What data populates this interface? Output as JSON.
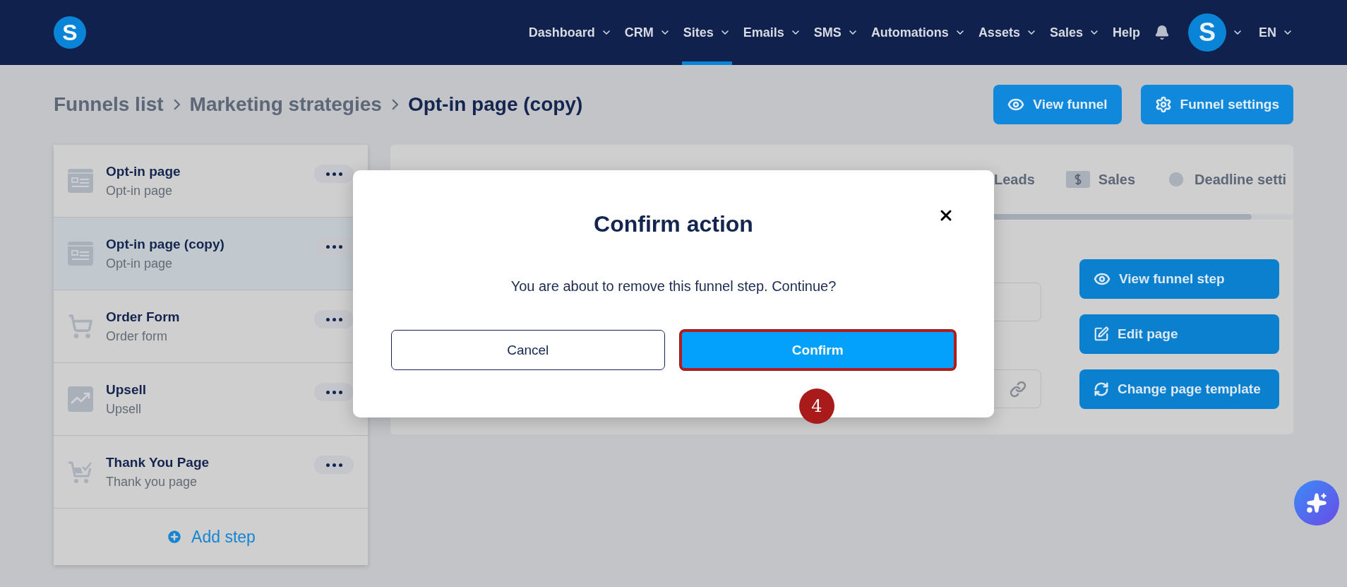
{
  "nav": {
    "logo": "S",
    "items": [
      {
        "label": "Dashboard",
        "selected": false,
        "dropdown": true
      },
      {
        "label": "CRM",
        "selected": false,
        "dropdown": true
      },
      {
        "label": "Sites",
        "selected": true,
        "dropdown": true
      },
      {
        "label": "Emails",
        "selected": false,
        "dropdown": true
      },
      {
        "label": "SMS",
        "selected": false,
        "dropdown": true
      },
      {
        "label": "Automations",
        "selected": false,
        "dropdown": true
      },
      {
        "label": "Assets",
        "selected": false,
        "dropdown": true
      },
      {
        "label": "Sales",
        "selected": false,
        "dropdown": true
      },
      {
        "label": "Help",
        "selected": false,
        "dropdown": false
      }
    ],
    "avatar": "S",
    "language": "EN"
  },
  "breadcrumb": [
    {
      "label": "Funnels list",
      "current": false
    },
    {
      "label": "Marketing strategies",
      "current": false
    },
    {
      "label": "Opt-in page (copy)",
      "current": true
    }
  ],
  "header_buttons": [
    {
      "label": "View funnel",
      "kind": "view"
    },
    {
      "label": "Funnel settings",
      "kind": "settings"
    }
  ],
  "steps": [
    {
      "title": "Opt-in page",
      "subtitle": "Opt-in page",
      "kind": "page",
      "selected": false
    },
    {
      "title": "Opt-in page (copy)",
      "subtitle": "Opt-in page",
      "kind": "page",
      "selected": true
    },
    {
      "title": "Order Form",
      "subtitle": "Order form",
      "kind": "cart",
      "selected": false
    },
    {
      "title": "Upsell",
      "subtitle": "Upsell",
      "kind": "upsell",
      "selected": false
    },
    {
      "title": "Thank You Page",
      "subtitle": "Thank you page",
      "kind": "thanks",
      "selected": false
    }
  ],
  "add_step": "Add step",
  "tabs": [
    {
      "label": "Leads",
      "kind": "leads"
    },
    {
      "label": "Sales",
      "kind": "sales"
    },
    {
      "label": "Deadline setti",
      "kind": "deadline"
    }
  ],
  "actions": [
    {
      "label": "View funnel step",
      "kind": "view"
    },
    {
      "label": "Edit page",
      "kind": "edit"
    },
    {
      "label": "Change page template",
      "kind": "template"
    }
  ],
  "dialog": {
    "title": "Confirm action",
    "message": "You are about to remove this funnel step. Continue?",
    "cancel": "Cancel",
    "confirm": "Confirm",
    "confirm_highlighted": true
  },
  "step_marker": "4"
}
